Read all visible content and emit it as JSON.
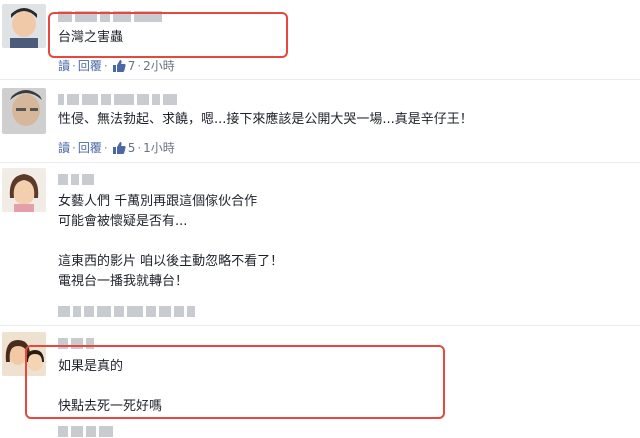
{
  "comments": [
    {
      "text": "台灣之害蟲",
      "reply_label": "讀",
      "reply2_label": "回覆",
      "likes": "7",
      "time": "2小時"
    },
    {
      "text": "性侵、無法勃起、求饒，嗯...接下來應該是公開大哭一場...真是辛仔王！",
      "reply_label": "讀",
      "reply2_label": "回覆",
      "likes": "5",
      "time": "1小時"
    },
    {
      "text": "女藝人們 千萬別再跟這個傢伙合作\n可能會被懷疑是否有...\n\n這東西的影片 咱以後主動忽略不看了！\n電視台一播我就轉台！"
    },
    {
      "text": "如果是真的\n\n快點去死一死好嗎"
    }
  ],
  "colors": {
    "highlight": "#e8473e",
    "link": "#4b68a6"
  },
  "icons": {
    "like": "thumbs-up-icon"
  }
}
